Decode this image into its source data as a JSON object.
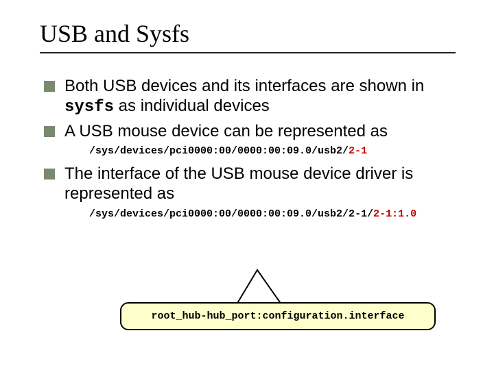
{
  "title": "USB and Sysfs",
  "bullets": {
    "b1_pre": "Both USB devices and its interfaces are shown in ",
    "b1_code": "sysfs",
    "b1_post": " as individual devices",
    "b2": "A USB mouse device can be represented as",
    "b2_code_pre": "/sys/devices/pci0000:00/0000:00:09.0/usb2/",
    "b2_code_hl": "2-1",
    "b3": "The interface of the USB mouse device driver is represented as",
    "b3_code_pre": "/sys/devices/pci0000:00/0000:00:09.0/usb2/2-1/",
    "b3_code_hl": "2-1:1.0"
  },
  "callout": "root_hub-hub_port:configuration.interface"
}
